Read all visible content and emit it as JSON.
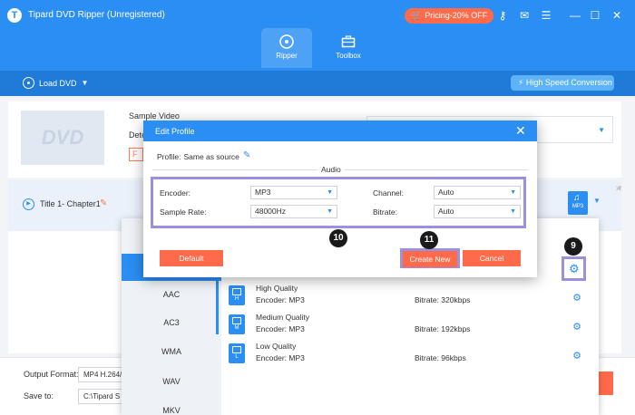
{
  "app": {
    "title": "Tipard DVD Ripper (Unregistered)",
    "pricing": "Pricing-20% OFF",
    "tabs": [
      {
        "label": "Ripper"
      },
      {
        "label": "Toolbox"
      }
    ]
  },
  "toolbar": {
    "load_dvd": "Load DVD",
    "high_speed": "High Speed Conversion"
  },
  "source": {
    "sample_video": "Sample Video",
    "detect": "Dete",
    "full": "F",
    "thumb_text": "DVD"
  },
  "title_row": {
    "chapter": "Title 1- Chapter1",
    "badge": "MP3"
  },
  "dialog": {
    "title": "Edit Profile",
    "profile_label": "Profile:",
    "profile_value": "Same as source",
    "section": "Audio",
    "encoder_label": "Encoder:",
    "encoder_value": "MP3",
    "sample_rate_label": "Sample Rate:",
    "sample_rate_value": "48000Hz",
    "channel_label": "Channel:",
    "channel_value": "Auto",
    "bitrate_label": "Bitrate:",
    "bitrate_value": "Auto",
    "default_btn": "Default",
    "create_btn": "Create New",
    "cancel_btn": "Cancel"
  },
  "format_panel": {
    "categories": [
      "AAC",
      "AC3",
      "WMA",
      "WAV",
      "MKV"
    ],
    "qualities": [
      {
        "name": "High Quality",
        "encoder": "Encoder: MP3",
        "bitrate": "Bitrate: 320kbps",
        "level": "H"
      },
      {
        "name": "Medium Quality",
        "encoder": "Encoder: MP3",
        "bitrate": "Bitrate: 192kbps",
        "level": "M"
      },
      {
        "name": "Low Quality",
        "encoder": "Encoder: MP3",
        "bitrate": "Bitrate: 96kbps",
        "level": "L"
      }
    ]
  },
  "bottom": {
    "output_format_label": "Output Format:",
    "output_format_value": "MP4 H.264/",
    "save_to_label": "Save to:",
    "save_to_value": "C:\\Tipard S"
  },
  "steps": [
    "9",
    "10",
    "11"
  ],
  "colors": {
    "brand_blue": "#2b8ef2",
    "accent_orange": "#ff6b4a",
    "highlight_purple": "#9b8fe0"
  }
}
